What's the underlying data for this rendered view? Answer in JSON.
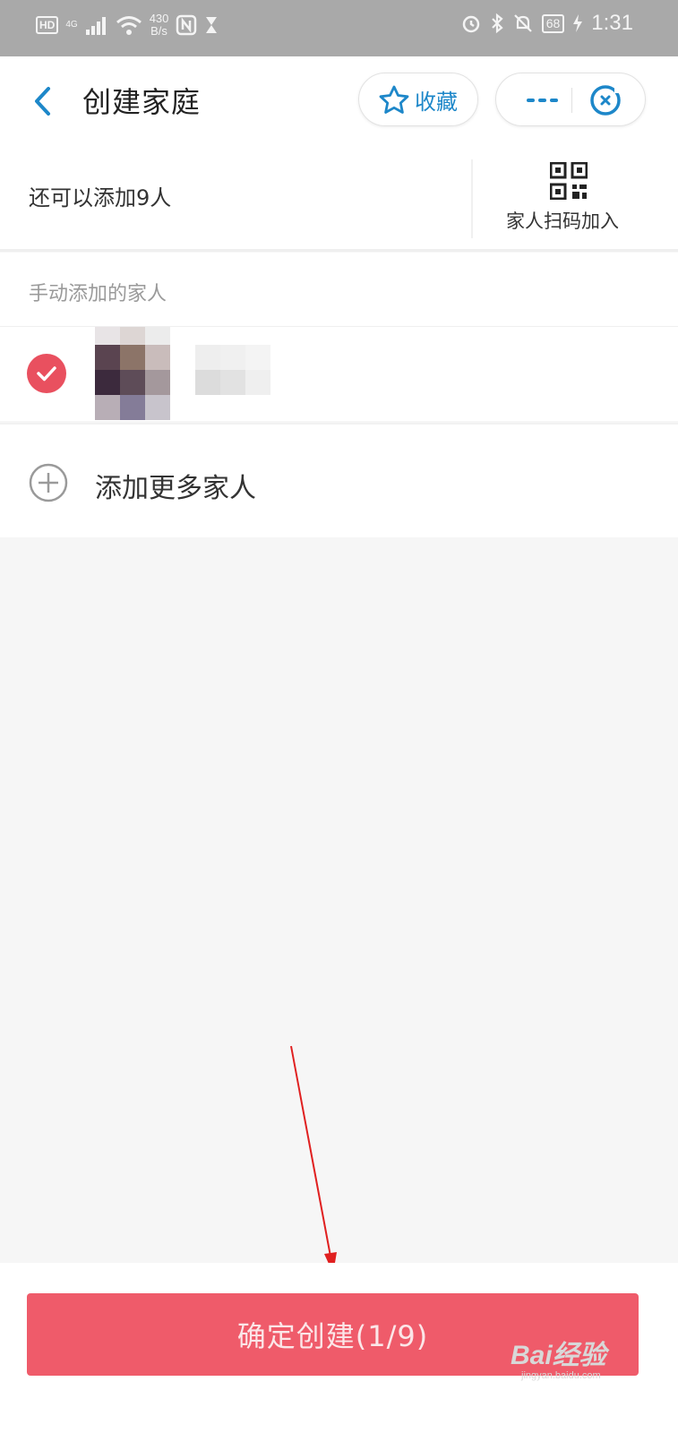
{
  "status_bar": {
    "hd": "HD",
    "network": "4G",
    "speed_value": "430",
    "speed_unit": "B/s",
    "battery": "68",
    "time": "1:31"
  },
  "header": {
    "title": "创建家庭",
    "favorite_label": "收藏"
  },
  "invite": {
    "remaining_text": "还可以添加9人",
    "scan_label": "家人扫码加入"
  },
  "manual": {
    "section_label": "手动添加的家人",
    "add_more_label": "添加更多家人"
  },
  "footer": {
    "confirm_label": "确定创建(1/9)"
  },
  "watermark": {
    "brand": "Bai经验",
    "sub": "jingyan.baidu.com"
  },
  "colors": {
    "accent_blue": "#1d87c9",
    "accent_red": "#ef5b6a"
  }
}
